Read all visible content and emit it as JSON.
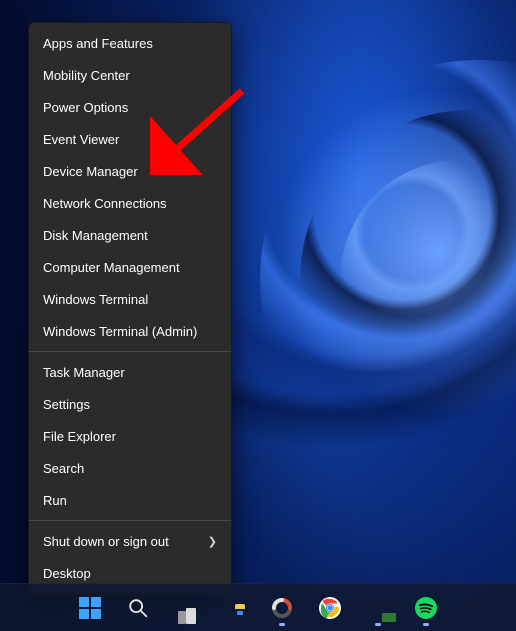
{
  "menu": {
    "groups": [
      [
        {
          "label": "Apps and Features",
          "name": "menu-apps-and-features"
        },
        {
          "label": "Mobility Center",
          "name": "menu-mobility-center"
        },
        {
          "label": "Power Options",
          "name": "menu-power-options"
        },
        {
          "label": "Event Viewer",
          "name": "menu-event-viewer"
        },
        {
          "label": "Device Manager",
          "name": "menu-device-manager"
        },
        {
          "label": "Network Connections",
          "name": "menu-network-connections"
        },
        {
          "label": "Disk Management",
          "name": "menu-disk-management"
        },
        {
          "label": "Computer Management",
          "name": "menu-computer-management"
        },
        {
          "label": "Windows Terminal",
          "name": "menu-windows-terminal"
        },
        {
          "label": "Windows Terminal (Admin)",
          "name": "menu-windows-terminal-admin"
        }
      ],
      [
        {
          "label": "Task Manager",
          "name": "menu-task-manager"
        },
        {
          "label": "Settings",
          "name": "menu-settings"
        },
        {
          "label": "File Explorer",
          "name": "menu-file-explorer"
        },
        {
          "label": "Search",
          "name": "menu-search"
        },
        {
          "label": "Run",
          "name": "menu-run"
        }
      ],
      [
        {
          "label": "Shut down or sign out",
          "name": "menu-shutdown-or-signout",
          "submenu": true
        },
        {
          "label": "Desktop",
          "name": "menu-desktop"
        }
      ]
    ]
  },
  "annotation": {
    "target": "menu-device-manager",
    "arrow_color": "#ff0000"
  },
  "taskbar": {
    "items": [
      {
        "name": "start-button",
        "icon": "windows-logo-icon",
        "active": false
      },
      {
        "name": "search-button",
        "icon": "search-icon",
        "active": false
      },
      {
        "name": "task-view-button",
        "icon": "task-view-icon",
        "active": false
      },
      {
        "name": "file-explorer-button",
        "icon": "folder-icon",
        "active": false
      },
      {
        "name": "powertoys-button",
        "icon": "ring-icon",
        "active": true
      },
      {
        "name": "chrome-button",
        "icon": "chrome-icon",
        "active": false
      },
      {
        "name": "green-app-button",
        "icon": "green-app-icon",
        "active": true
      },
      {
        "name": "spotify-button",
        "icon": "spotify-icon",
        "active": true
      }
    ]
  },
  "colors": {
    "menu_bg": "#2b2b2b",
    "menu_text": "#ffffff",
    "accent": "#3aa3ff"
  }
}
